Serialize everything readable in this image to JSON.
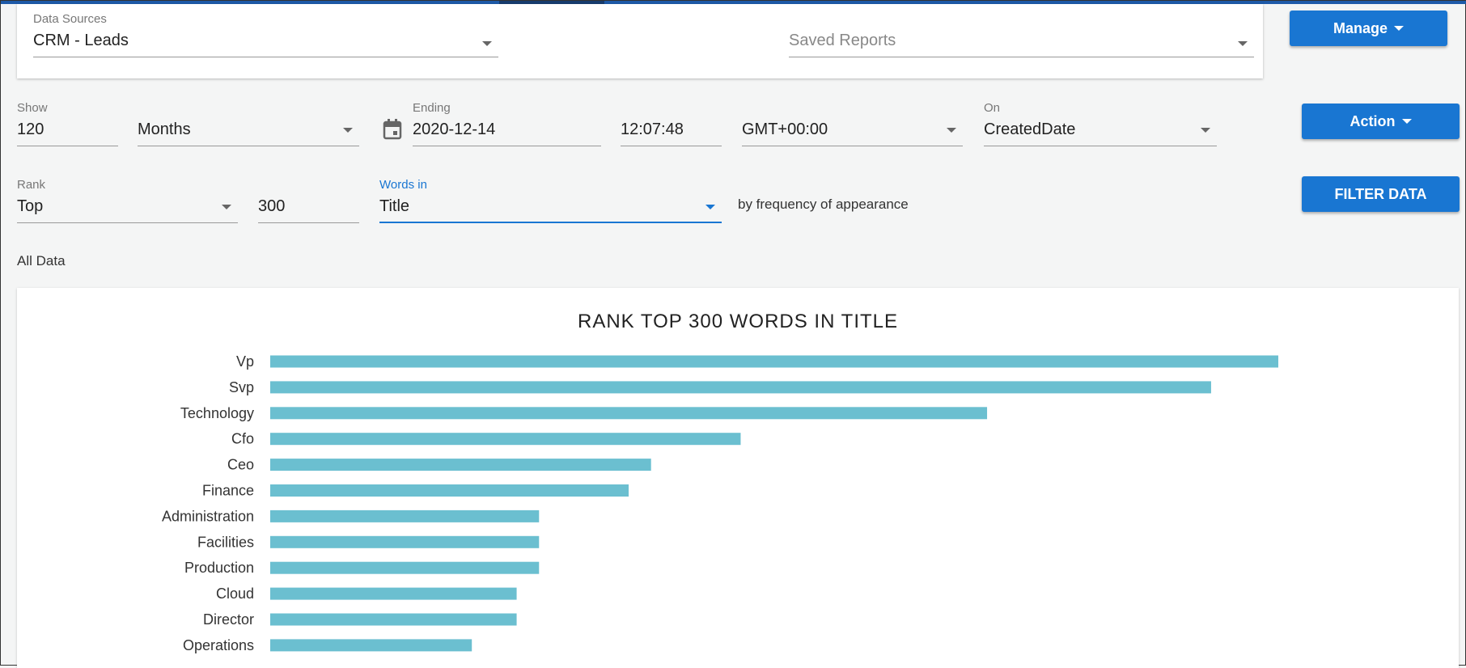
{
  "data_sources": {
    "label": "Data Sources",
    "value": "CRM - Leads"
  },
  "saved_reports": {
    "placeholder": "Saved Reports"
  },
  "manage_button": "Manage",
  "show": {
    "label": "Show",
    "value": "120"
  },
  "period": {
    "value": "Months"
  },
  "ending": {
    "label": "Ending",
    "date": "2020-12-14",
    "time": "12:07:48"
  },
  "timezone": {
    "value": "GMT+00:00"
  },
  "on": {
    "label": "On",
    "value": "CreatedDate"
  },
  "action_button": "Action",
  "rank": {
    "label": "Rank",
    "value": "Top",
    "count": "300"
  },
  "words_in": {
    "label": "Words in",
    "value": "Title"
  },
  "frequency_text": "by frequency of appearance",
  "filter_button": "FILTER DATA",
  "all_data_label": "All Data",
  "colors": {
    "primary": "#1976d2",
    "bar": "#6bbfd0"
  },
  "chart_data": {
    "type": "bar",
    "orientation": "horizontal",
    "title": "RANK TOP 300 WORDS IN TITLE",
    "categories": [
      "Vp",
      "Svp",
      "Technology",
      "Cfo",
      "Ceo",
      "Finance",
      "Administration",
      "Facilities",
      "Production",
      "Cloud",
      "Director",
      "Operations"
    ],
    "values": [
      45,
      42,
      32,
      21,
      17,
      16,
      12,
      12,
      12,
      11,
      11,
      9
    ],
    "xlim": [
      0,
      45
    ]
  }
}
